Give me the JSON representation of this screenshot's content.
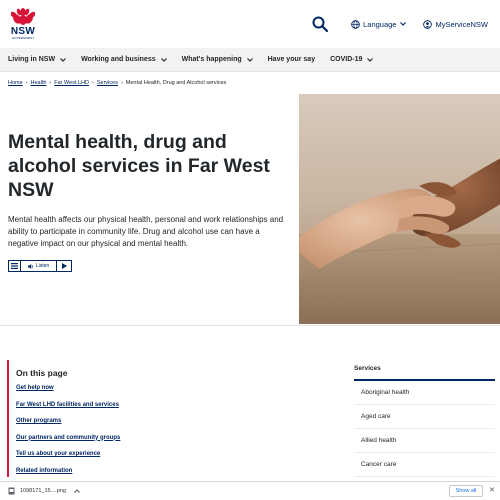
{
  "header": {
    "logo_text": "NSW",
    "logo_subtext": "GOVERNMENT",
    "language_label": "Language",
    "my_service_label": "MyServiceNSW"
  },
  "nav": {
    "items": [
      {
        "label": "Living in NSW",
        "dropdown": true
      },
      {
        "label": "Working and business",
        "dropdown": true
      },
      {
        "label": "What's happening",
        "dropdown": true
      },
      {
        "label": "Have your say",
        "dropdown": false
      },
      {
        "label": "COVID-19",
        "dropdown": true
      }
    ]
  },
  "breadcrumb": {
    "items": [
      "Home",
      "Health",
      "Far West LHD",
      "Services"
    ],
    "current": "Mental Health, Drug and Alcohol services"
  },
  "hero": {
    "title": "Mental health, drug and alcohol services in Far West NSW",
    "intro": "Mental health affects our physical health, personal and work relationships and ability to participate in community life. Drug and alcohol use can have a negative impact on our physical and mental health.",
    "listen_label": "Listen"
  },
  "on_this_page": {
    "title": "On this page",
    "links": [
      "Get help now",
      "Far West LHD facilities and services",
      "Other programs",
      "Our partners and community groups",
      "Tell us about your experience",
      "Related information"
    ]
  },
  "services": {
    "title": "Services",
    "items": [
      "Aboriginal health",
      "Aged care",
      "Allied health",
      "Cancer care"
    ]
  },
  "download_bar": {
    "file_name": "1098171_15....png",
    "show_all_label": "Show all"
  },
  "colors": {
    "brand_navy": "#002664",
    "brand_red": "#d7153a",
    "nav_bg": "#f2f2f2"
  }
}
